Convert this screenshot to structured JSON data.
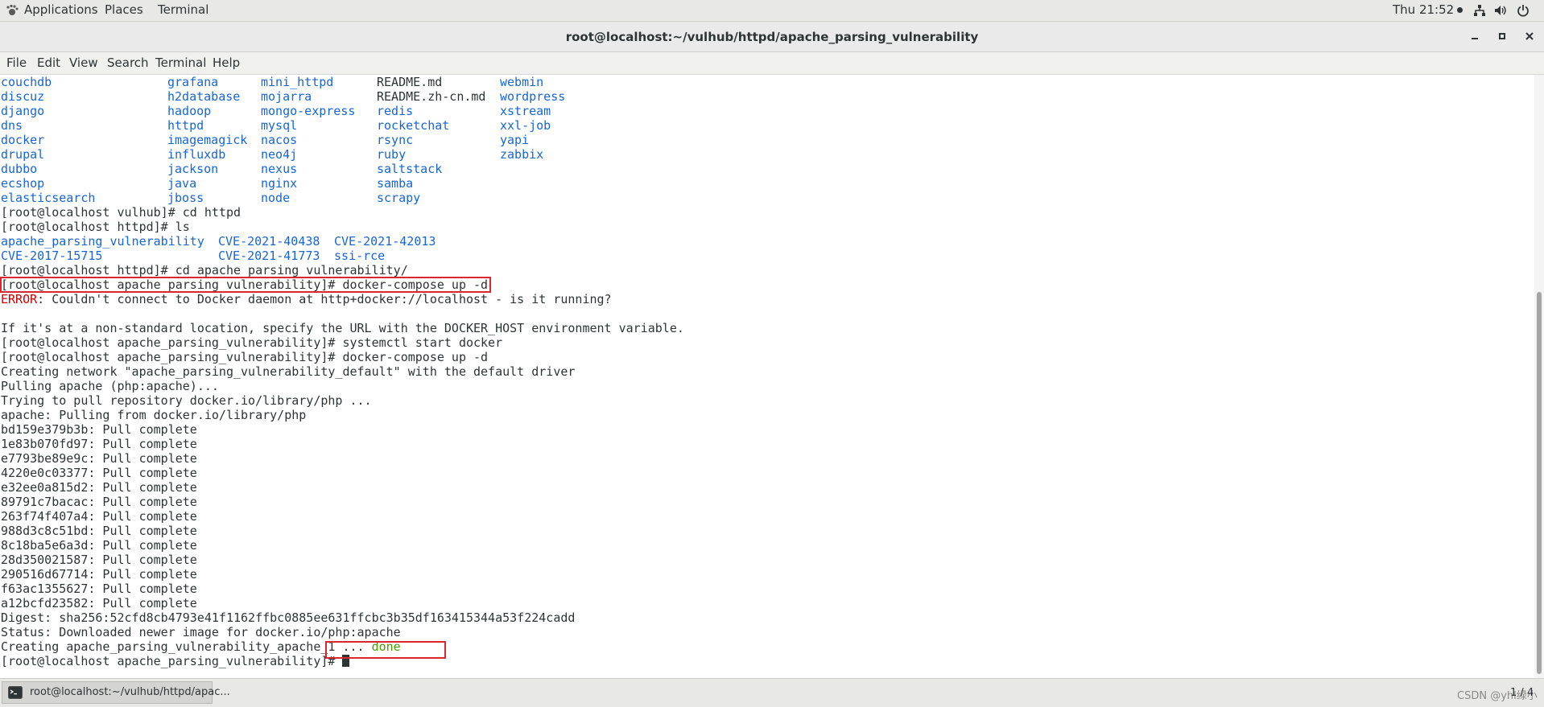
{
  "topbar": {
    "applications": "Applications",
    "places": "Places",
    "terminal": "Terminal",
    "clock": "Thu 21:52",
    "icons": [
      "network-icon",
      "volume-icon",
      "power-icon"
    ]
  },
  "window": {
    "title": "root@localhost:~/vulhub/httpd/apache_parsing_vulnerability"
  },
  "menubar": {
    "items": [
      "File",
      "Edit",
      "View",
      "Search",
      "Terminal",
      "Help"
    ]
  },
  "terminal": {
    "colors": {
      "directory": "#1866d1",
      "error": "#cc0000",
      "done": "#4e9a06",
      "highlight_box": "#d9282f"
    },
    "listing_rows": [
      [
        {
          "t": "couchdb",
          "c": "dir"
        },
        {
          "t": "grafana",
          "c": "dir"
        },
        {
          "t": "mini_httpd",
          "c": "dir"
        },
        {
          "t": "README.md",
          "c": "file"
        },
        {
          "t": "webmin",
          "c": "dir"
        }
      ],
      [
        {
          "t": "discuz",
          "c": "dir"
        },
        {
          "t": "h2database",
          "c": "dir"
        },
        {
          "t": "mojarra",
          "c": "dir"
        },
        {
          "t": "README.zh-cn.md",
          "c": "file"
        },
        {
          "t": "wordpress",
          "c": "dir"
        }
      ],
      [
        {
          "t": "django",
          "c": "dir"
        },
        {
          "t": "hadoop",
          "c": "dir"
        },
        {
          "t": "mongo-express",
          "c": "dir"
        },
        {
          "t": "redis",
          "c": "dir"
        },
        {
          "t": "xstream",
          "c": "dir"
        }
      ],
      [
        {
          "t": "dns",
          "c": "dir"
        },
        {
          "t": "httpd",
          "c": "dir"
        },
        {
          "t": "mysql",
          "c": "dir"
        },
        {
          "t": "rocketchat",
          "c": "dir"
        },
        {
          "t": "xxl-job",
          "c": "dir"
        }
      ],
      [
        {
          "t": "docker",
          "c": "dir"
        },
        {
          "t": "imagemagick",
          "c": "dir"
        },
        {
          "t": "nacos",
          "c": "dir"
        },
        {
          "t": "rsync",
          "c": "dir"
        },
        {
          "t": "yapi",
          "c": "dir"
        }
      ],
      [
        {
          "t": "drupal",
          "c": "dir"
        },
        {
          "t": "influxdb",
          "c": "dir"
        },
        {
          "t": "neo4j",
          "c": "dir"
        },
        {
          "t": "ruby",
          "c": "dir"
        },
        {
          "t": "zabbix",
          "c": "dir"
        }
      ],
      [
        {
          "t": "dubbo",
          "c": "dir"
        },
        {
          "t": "jackson",
          "c": "dir"
        },
        {
          "t": "nexus",
          "c": "dir"
        },
        {
          "t": "saltstack",
          "c": "dir"
        },
        {
          "t": "",
          "c": "dir"
        }
      ],
      [
        {
          "t": "ecshop",
          "c": "dir"
        },
        {
          "t": "java",
          "c": "dir"
        },
        {
          "t": "nginx",
          "c": "dir"
        },
        {
          "t": "samba",
          "c": "dir"
        },
        {
          "t": "",
          "c": "dir"
        }
      ],
      [
        {
          "t": "elasticsearch",
          "c": "dir"
        },
        {
          "t": "jboss",
          "c": "dir"
        },
        {
          "t": "node",
          "c": "dir"
        },
        {
          "t": "scrapy",
          "c": "dir"
        },
        {
          "t": "",
          "c": "dir"
        }
      ]
    ],
    "cmd_cd_httpd": "[root@localhost vulhub]# cd httpd",
    "cmd_ls": "[root@localhost httpd]# ls",
    "httpd_rows": [
      [
        {
          "t": "apache_parsing_vulnerability",
          "c": "dir"
        },
        {
          "t": "CVE-2021-40438",
          "c": "dir"
        },
        {
          "t": "CVE-2021-42013",
          "c": "dir"
        }
      ],
      [
        {
          "t": "CVE-2017-15715",
          "c": "dir"
        },
        {
          "t": "CVE-2021-41773",
          "c": "dir"
        },
        {
          "t": "ssi-rce",
          "c": "dir"
        }
      ]
    ],
    "cmd_cd_apache": "[root@localhost httpd]# cd apache_parsing_vulnerability/",
    "cmd_compose_1": "[root@localhost apache_parsing_vulnerability]# docker-compose up -d",
    "error_label": "ERROR",
    "error_msg": ": Couldn't connect to Docker daemon at http+docker://localhost - is it running?",
    "blank": "",
    "hint": "If it's at a non-standard location, specify the URL with the DOCKER_HOST environment variable.",
    "cmd_systemctl": "[root@localhost apache_parsing_vulnerability]# systemctl start docker",
    "cmd_compose_2": "[root@localhost apache_parsing_vulnerability]# docker-compose up -d",
    "creating_network": "Creating network \"apache_parsing_vulnerability_default\" with the default driver",
    "pulling_apache": "Pulling apache (php:apache)...",
    "trying_pull": "Trying to pull repository docker.io/library/php ...",
    "apache_pulling": "apache: Pulling from docker.io/library/php",
    "layers": [
      "bd159e379b3b: Pull complete",
      "1e83b070fd97: Pull complete",
      "e7793be89e9c: Pull complete",
      "4220e0c03377: Pull complete",
      "e32ee0a815d2: Pull complete",
      "89791c7bacac: Pull complete",
      "263f74f407a4: Pull complete",
      "988d3c8c51bd: Pull complete",
      "8c18ba5e6a3d: Pull complete",
      "28d350021587: Pull complete",
      "290516d67714: Pull complete",
      "f63ac1355627: Pull complete",
      "a12bcfd23582: Pull complete"
    ],
    "digest": "Digest: sha256:52cfd8cb4793e41f1162ffbc0885ee631ffcbc3b35df163415344a53f224cadd",
    "status": "Status: Downloaded newer image for docker.io/php:apache",
    "creating_container": "Creating apache_parsing_vulnerability_apache_1 ... ",
    "done": "done",
    "final_prompt": "[root@localhost apache_parsing_vulnerability]# "
  },
  "bottombar": {
    "task_label": "root@localhost:~/vulhub/httpd/apac...",
    "workspace": "1 / 4",
    "watermark": "CSDN @yhl绿小"
  }
}
